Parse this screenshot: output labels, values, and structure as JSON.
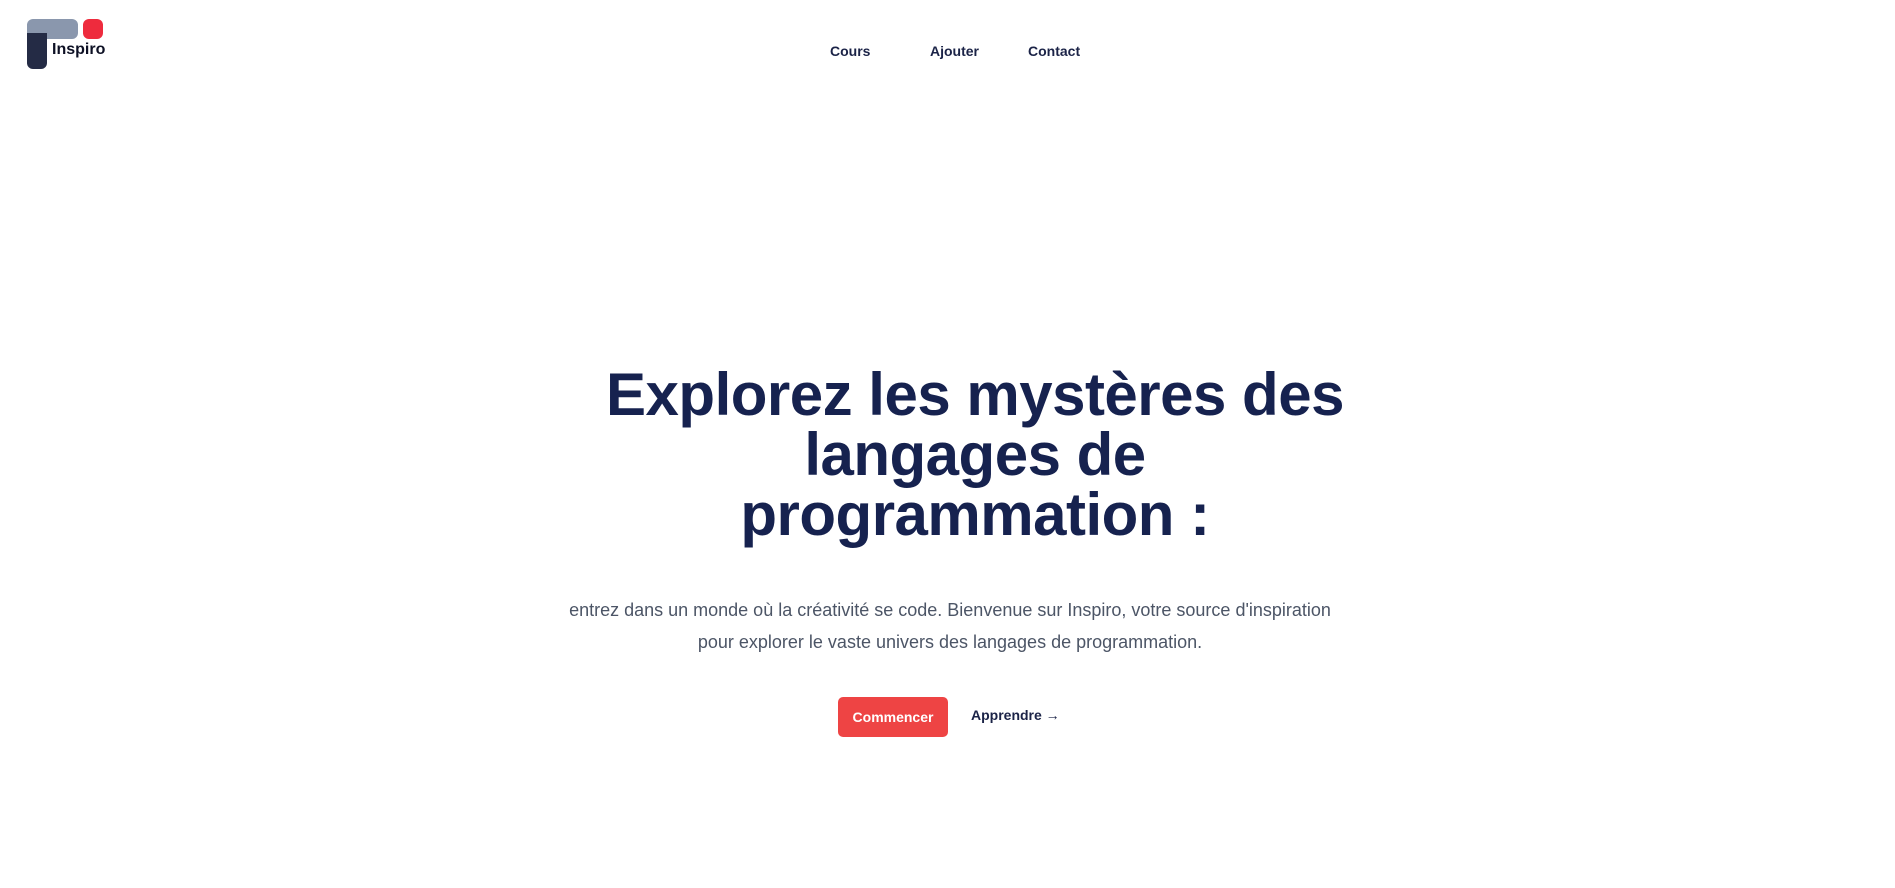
{
  "brand": {
    "name": "Inspiro",
    "colors": {
      "top": "#8a97ad",
      "side": "#242b45",
      "dot": "#ee2b3d"
    }
  },
  "nav": {
    "items": [
      {
        "label": "Cours"
      },
      {
        "label": "Ajouter"
      },
      {
        "label": "Contact"
      }
    ]
  },
  "hero": {
    "title": "Explorez les mystères des langages de programmation :",
    "description": "entrez dans un monde où la créativité se code. Bienvenue sur Inspiro, votre source d'inspiration pour explorer le vaste univers des langages de programmation.",
    "primary_button": "Commencer",
    "secondary_link": "Apprendre →"
  },
  "colors": {
    "accent": "#ee4444",
    "heading": "#16224f",
    "text": "#4c5566"
  }
}
